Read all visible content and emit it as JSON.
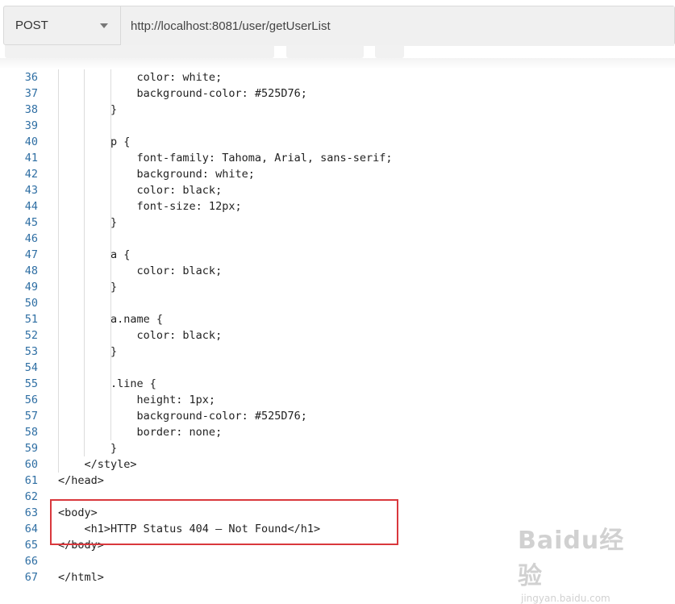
{
  "request": {
    "method": "POST",
    "url": "http://localhost:8081/user/getUserList"
  },
  "code": {
    "lines": [
      {
        "no": "36",
        "text": "            color: white;"
      },
      {
        "no": "37",
        "text": "            background-color: #525D76;"
      },
      {
        "no": "38",
        "text": "        }"
      },
      {
        "no": "39",
        "text": ""
      },
      {
        "no": "40",
        "text": "        p {"
      },
      {
        "no": "41",
        "text": "            font-family: Tahoma, Arial, sans-serif;"
      },
      {
        "no": "42",
        "text": "            background: white;"
      },
      {
        "no": "43",
        "text": "            color: black;"
      },
      {
        "no": "44",
        "text": "            font-size: 12px;"
      },
      {
        "no": "45",
        "text": "        }"
      },
      {
        "no": "46",
        "text": ""
      },
      {
        "no": "47",
        "text": "        a {"
      },
      {
        "no": "48",
        "text": "            color: black;"
      },
      {
        "no": "49",
        "text": "        }"
      },
      {
        "no": "50",
        "text": ""
      },
      {
        "no": "51",
        "text": "        a.name {"
      },
      {
        "no": "52",
        "text": "            color: black;"
      },
      {
        "no": "53",
        "text": "        }"
      },
      {
        "no": "54",
        "text": ""
      },
      {
        "no": "55",
        "text": "        .line {"
      },
      {
        "no": "56",
        "text": "            height: 1px;"
      },
      {
        "no": "57",
        "text": "            background-color: #525D76;"
      },
      {
        "no": "58",
        "text": "            border: none;"
      },
      {
        "no": "59",
        "text": "        }"
      },
      {
        "no": "60",
        "text": "    </style>"
      },
      {
        "no": "61",
        "text": "</head>"
      },
      {
        "no": "62",
        "text": ""
      },
      {
        "no": "63",
        "text": "<body>"
      },
      {
        "no": "64",
        "text": "    <h1>HTTP Status 404 – Not Found</h1>"
      },
      {
        "no": "65",
        "text": "</body>"
      },
      {
        "no": "66",
        "text": ""
      },
      {
        "no": "67",
        "text": "</html>"
      }
    ]
  },
  "watermark": {
    "logo": "Baidu经验",
    "sub": "jingyan.baidu.com"
  }
}
